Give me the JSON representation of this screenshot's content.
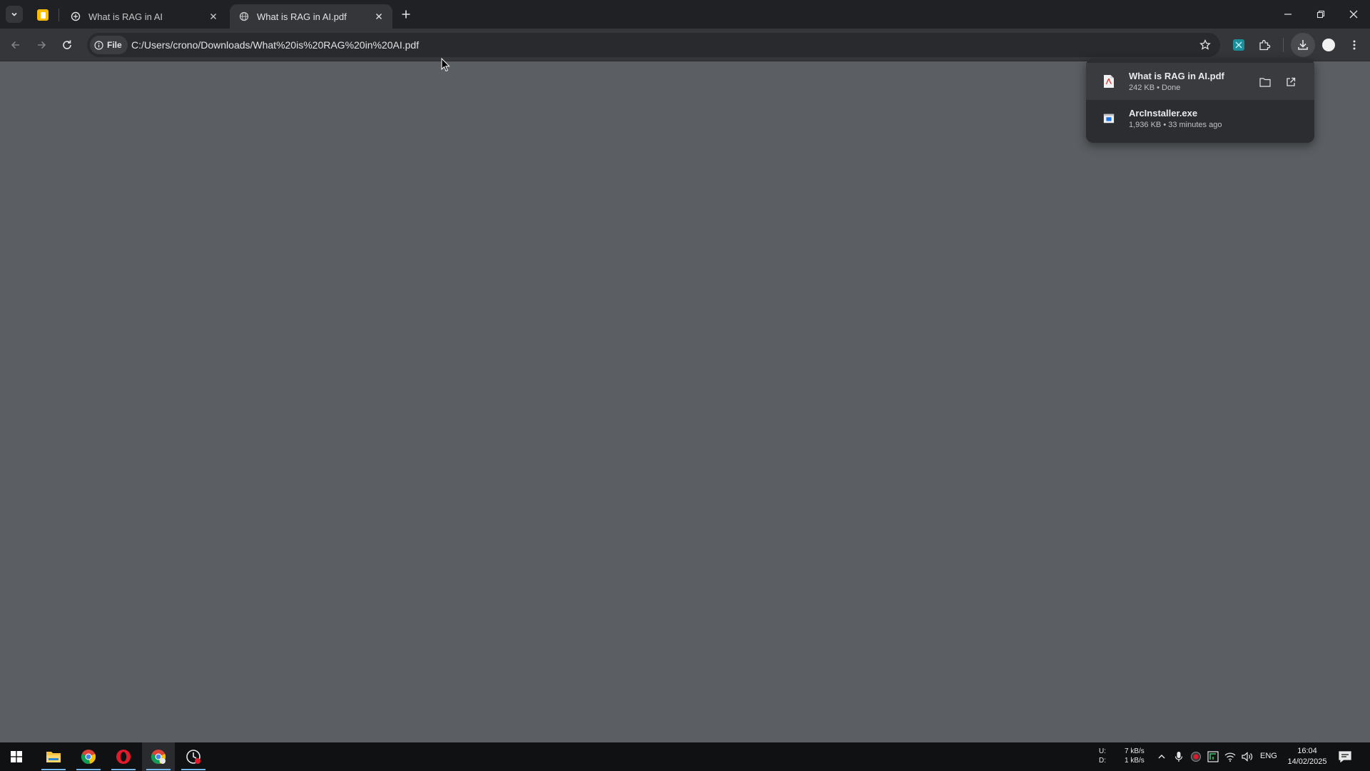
{
  "browser": {
    "tabs": [
      {
        "title": "What is RAG in AI",
        "favicon": "ai-site-icon",
        "active": false
      },
      {
        "title": "What is RAG in AI.pdf",
        "favicon": "globe-icon",
        "active": true
      }
    ],
    "pinned_tab_icon": "google-keep-icon",
    "omnibox": {
      "chip_label": "File",
      "url": "C:/Users/crono/Downloads/What%20is%20RAG%20in%20AI.pdf"
    }
  },
  "downloads": {
    "items": [
      {
        "name": "What is RAG in AI.pdf",
        "meta": "242 KB • Done",
        "icon": "pdf-file-icon"
      },
      {
        "name": "ArcInstaller.exe",
        "meta": "1,936 KB • 33 minutes ago",
        "icon": "exe-file-icon"
      }
    ]
  },
  "taskbar": {
    "net_upload_label": "U:",
    "net_upload_value": "7 kB/s",
    "net_download_label": "D:",
    "net_download_value": "1 kB/s",
    "language": "ENG",
    "time": "16:04",
    "date": "14/02/2025"
  },
  "colors": {
    "page_bg": "#5b5f63",
    "tabstrip_bg": "#202124",
    "toolbar_bg": "#35363a",
    "bubble_bg": "#2c2d30",
    "taskbar_bg": "#101113"
  }
}
